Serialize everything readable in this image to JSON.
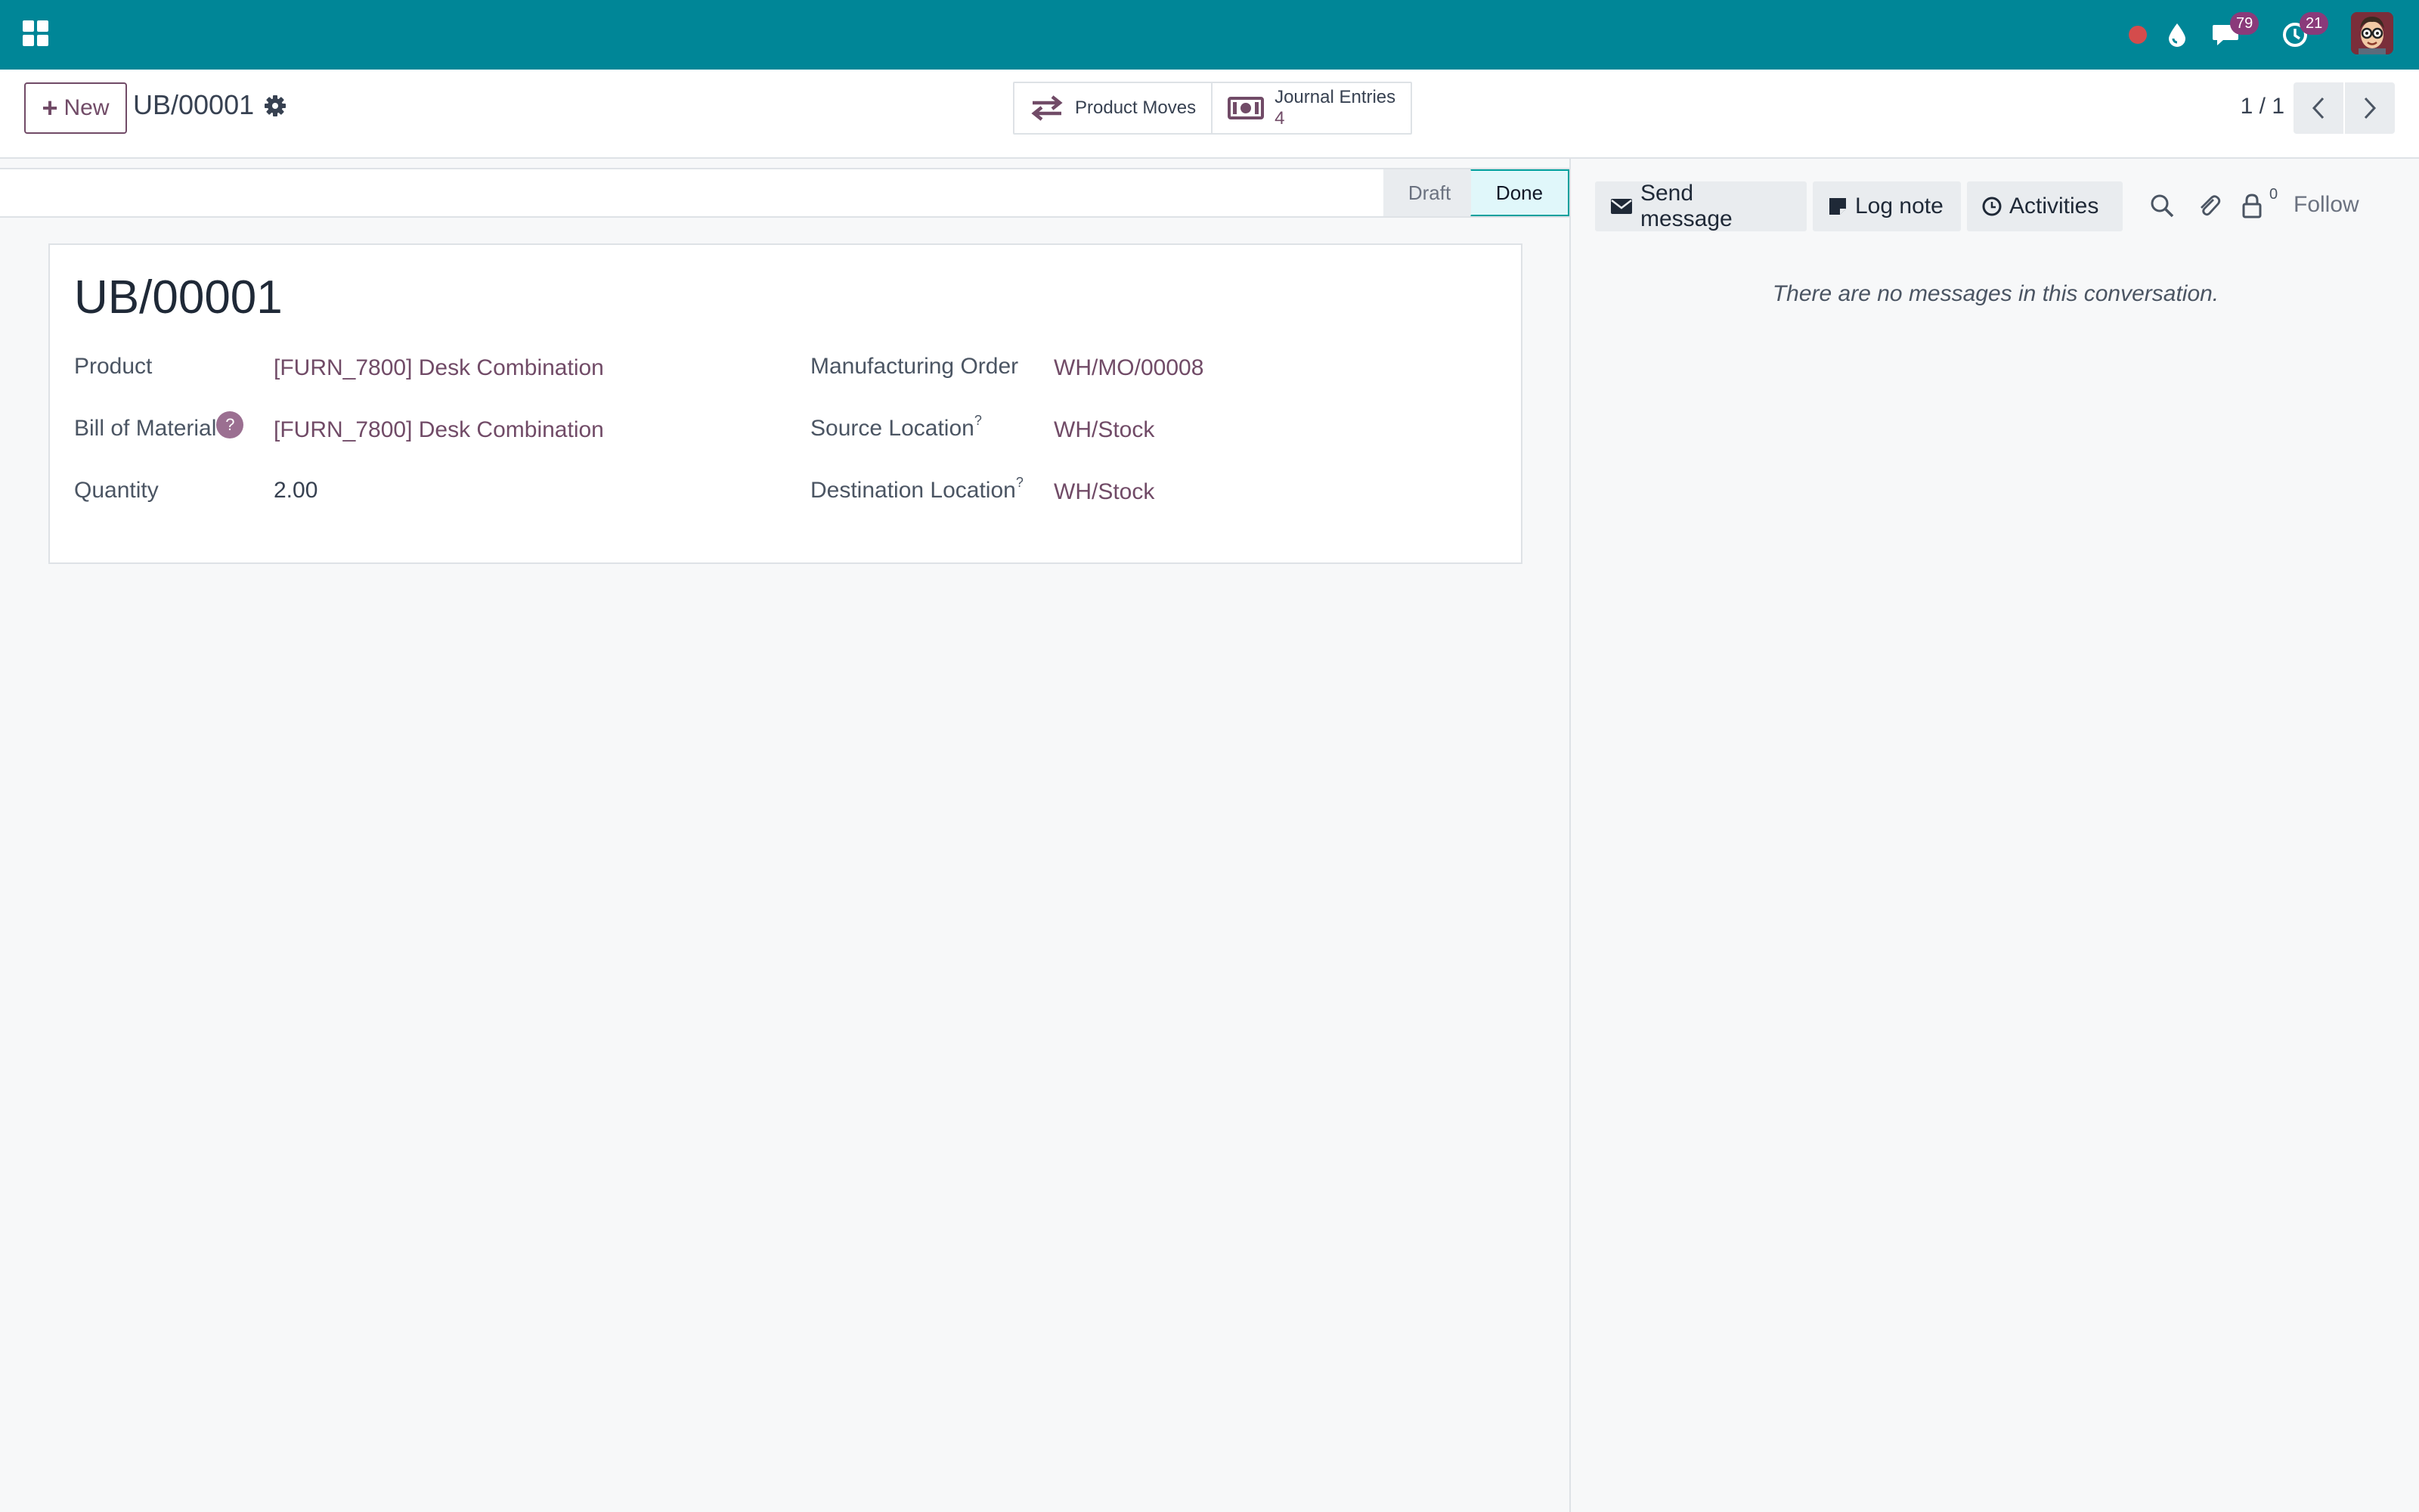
{
  "navbar": {
    "chat_badge": "79",
    "activity_badge": "21",
    "icons": [
      "apps-icon",
      "record-dot-icon",
      "drop-icon",
      "chat-icon",
      "clock-icon",
      "avatar"
    ]
  },
  "control": {
    "new_label": "New",
    "record_title": "UB/00001",
    "smart_buttons": {
      "product_moves": "Product Moves",
      "journal_entries": "Journal Entries",
      "journal_entries_count": "4"
    },
    "pager": "1 / 1"
  },
  "statusbar": {
    "stages": [
      "Draft",
      "Done"
    ],
    "active": "Done"
  },
  "form": {
    "reference": "UB/00001",
    "product_label": "Product",
    "product_value": "[FURN_7800] Desk Combination",
    "bom_label": "Bill of Material",
    "bom_help": "?",
    "bom_value": "[FURN_7800] Desk Combination",
    "quantity_label": "Quantity",
    "quantity_value": "2.00",
    "mo_label": "Manufacturing Order",
    "mo_value": "WH/MO/00008",
    "source_label": "Source Location",
    "source_value": "WH/Stock",
    "dest_label": "Destination Location",
    "dest_value": "WH/Stock",
    "help_mark": "?"
  },
  "chatter": {
    "send_message": "Send message",
    "log_note": "Log note",
    "activities": "Activities",
    "follower_count": "0",
    "follow": "Follow",
    "empty_text": "There are no messages in this conversation."
  },
  "colors": {
    "navbar": "#008697",
    "brand": "#714b67",
    "done_stage": "#00a09d"
  }
}
